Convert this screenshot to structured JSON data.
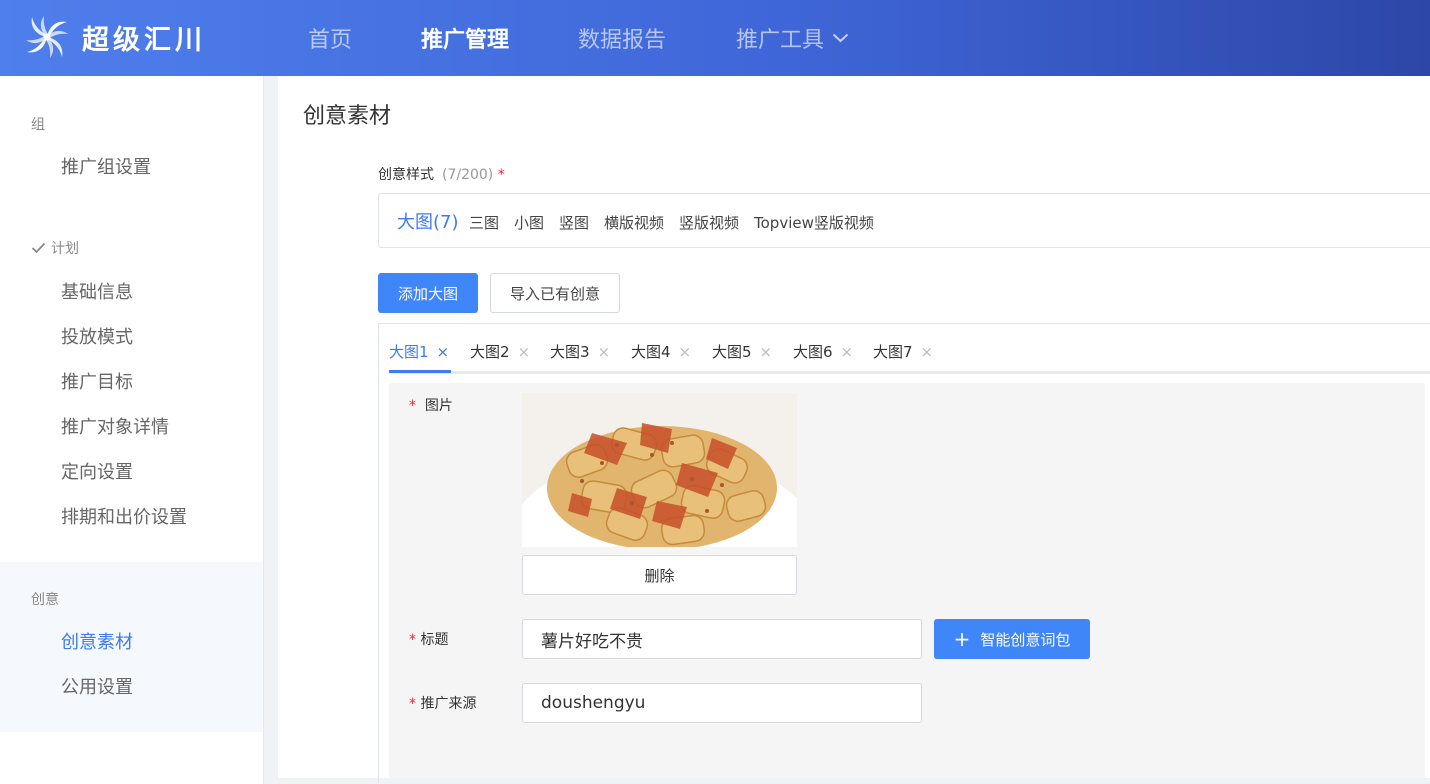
{
  "header": {
    "logo_text": "超级汇川",
    "nav": {
      "home": "首页",
      "manage": "推广管理",
      "report": "数据报告",
      "tools": "推广工具"
    }
  },
  "sidebar": {
    "group_label": "组",
    "group_items": [
      "推广组设置"
    ],
    "plan_label": "计划",
    "plan_items": [
      "基础信息",
      "投放模式",
      "推广目标",
      "推广对象详情",
      "定向设置",
      "排期和出价设置"
    ],
    "creative_label": "创意",
    "creative_items": [
      "创意素材",
      "公用设置"
    ]
  },
  "main": {
    "page_title": "创意素材",
    "style_field": {
      "label": "创意样式",
      "count": "(7/200)",
      "required": "*",
      "options": [
        "大图(7)",
        "三图",
        "小图",
        "竖图",
        "横版视频",
        "竖版视频",
        "Topview竖版视频"
      ]
    },
    "add_button": "添加大图",
    "import_button": "导入已有创意",
    "tabs": [
      "大图1",
      "大图2",
      "大图3",
      "大图4",
      "大图5",
      "大图6",
      "大图7"
    ],
    "tab_close": "×",
    "form": {
      "image_label": "图片",
      "delete_button": "删除",
      "title_label": "标题",
      "title_value": "薯片好吃不贵",
      "smart_button": "智能创意词包",
      "smart_plus": "+",
      "source_label": "推广来源",
      "source_value": "doushengyu"
    }
  },
  "colors": {
    "accent": "#3f86f8",
    "nav_gradient_start": "#4f7fec",
    "nav_gradient_end": "#2d47a8",
    "required": "#f5222d"
  },
  "icons": {
    "logo": "swirl-logo-icon",
    "dropdown": "chevron-down-icon",
    "check": "check-icon"
  }
}
